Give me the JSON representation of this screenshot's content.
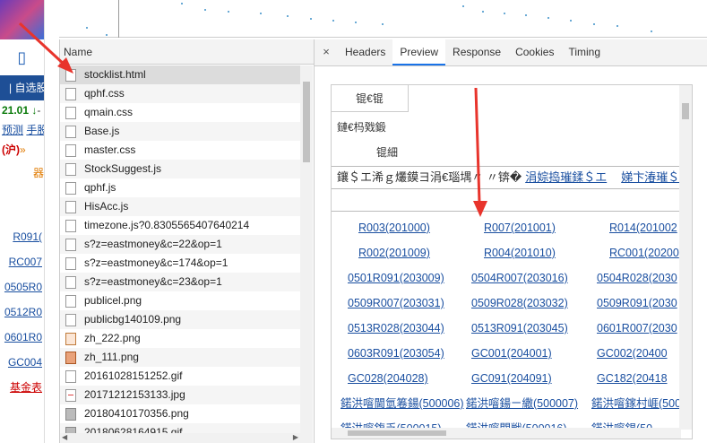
{
  "background_page": {
    "blue_bar": "自选股",
    "price_row": {
      "value": "21.01",
      "arrow": "↓",
      "suffix": "-"
    },
    "links_row": [
      "预测",
      "手股"
    ],
    "market_row": {
      "label": "(沪)",
      "mark": "»"
    },
    "icon_char": "器",
    "side_links": [
      "R091(",
      "RC007",
      "0505R0",
      "0512R0",
      "0601R0",
      "GC004",
      "基金表"
    ]
  },
  "network": {
    "header": "Name",
    "files": [
      {
        "name": "stocklist.html",
        "icon": "doc-icon"
      },
      {
        "name": "qphf.css",
        "icon": "doc-icon"
      },
      {
        "name": "qmain.css",
        "icon": "doc-icon"
      },
      {
        "name": "Base.js",
        "icon": "doc-icon"
      },
      {
        "name": "master.css",
        "icon": "doc-icon"
      },
      {
        "name": "StockSuggest.js",
        "icon": "doc-icon"
      },
      {
        "name": "qphf.js",
        "icon": "doc-icon"
      },
      {
        "name": "HisAcc.js",
        "icon": "doc-icon"
      },
      {
        "name": "timezone.js?0.8305565407640214",
        "icon": "doc-icon"
      },
      {
        "name": "s?z=eastmoney&c=22&op=1",
        "icon": "doc-icon"
      },
      {
        "name": "s?z=eastmoney&c=174&op=1",
        "icon": "doc-icon"
      },
      {
        "name": "s?z=eastmoney&c=23&op=1",
        "icon": "doc-icon"
      },
      {
        "name": "publicel.png",
        "icon": "doc-icon"
      },
      {
        "name": "publicbg140109.png",
        "icon": "doc-icon"
      },
      {
        "name": "zh_222.png",
        "icon": "image-icon"
      },
      {
        "name": "zh_111.png",
        "icon": "image-icon"
      },
      {
        "name": "20161028151252.gif",
        "icon": "doc-icon"
      },
      {
        "name": "20171212153133.jpg",
        "icon": "image-line-icon"
      },
      {
        "name": "20180410170356.png",
        "icon": "image-gray-icon"
      },
      {
        "name": "20180628164915.gif",
        "icon": "image-gray-icon"
      }
    ]
  },
  "detail": {
    "close_glyph": "×",
    "tabs": [
      "Headers",
      "Preview",
      "Response",
      "Cookies",
      "Timing"
    ],
    "active_tab": "Preview"
  },
  "preview": {
    "garbled_1": "锟€锟",
    "garbled_2": "鏈€杩戣鍛",
    "garbled_3": "锟細",
    "bar_text": "鑲＄エ浠ｇ爜鏌ヨ涓€瑙堣〃 〃锛�",
    "bar_link_1": "涓婃捣璀鍒＄エ",
    "bar_link_2": "娣卞湷璀＄",
    "grid": [
      [
        "R003(201000)",
        "R007(201001)",
        "R014(201002"
      ],
      [
        "R002(201009)",
        "R004(201010)",
        "RC001(20200"
      ],
      [
        "0501R091(203009)",
        "0504R007(203016)",
        "0504R028(2030"
      ],
      [
        "0509R007(203031)",
        "0509R028(203032)",
        "0509R091(2030"
      ],
      [
        "0513R028(203044)",
        "0513R091(203045)",
        "0601R007(2030"
      ],
      [
        "0603R091(203054)",
        "GC001(204001)",
        "GC002(20400"
      ],
      [
        "GC028(204028)",
        "GC091(204091)",
        "GC182(20418"
      ],
      [
        "鍩洪噾閫氫箞鍚(500006)",
        "鍩洪噾鍚ㄧ繖(500007)",
        "鍩洪噾鎵村崕(500"
      ],
      [
        "鍩洪噾鍑乏(500015)",
        "鍩洪噾閲戦(500016)",
        "鍩洪噾鎾(50"
      ]
    ]
  },
  "colors": {
    "link": "#1a4fa0",
    "tab_accent": "#1a73e8",
    "arrow": "#e8342c",
    "blue_bar": "#1e4f96"
  }
}
